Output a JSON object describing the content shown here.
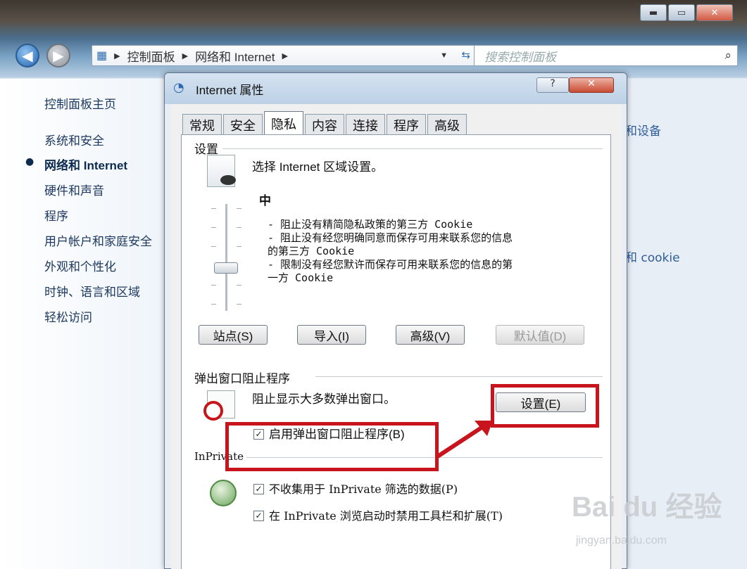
{
  "window": {
    "minimize": "▬",
    "maximize": "▭",
    "close": "✕"
  },
  "nav": {
    "back_icon": "◀",
    "forward_icon": "▶",
    "breadcrumb": [
      "控制面板",
      "网络和 Internet"
    ],
    "search_placeholder": "搜索控制面板"
  },
  "left_pane": {
    "home": "控制面板主页",
    "items": [
      "系统和安全",
      "网络和 Internet",
      "硬件和声音",
      "程序",
      "用户帐户和家庭安全",
      "外观和个性化",
      "时钟、语言和区域",
      "轻松访问"
    ],
    "active_index": 1
  },
  "right_fragments": [
    "和设备",
    "和 cookie"
  ],
  "dialog": {
    "title": "Internet 属性",
    "help": "?",
    "close": "✕",
    "tabs": [
      "常规",
      "安全",
      "隐私",
      "内容",
      "连接",
      "程序",
      "高级"
    ],
    "active_tab": "隐私",
    "settings_group": "设置",
    "settings_desc": "选择 Internet 区域设置。",
    "level": "中",
    "level_lines": [
      "- 阻止没有精简隐私政策的第三方 Cookie",
      "- 阻止没有经您明确同意而保存可用来联系您的信息",
      "的第三方 Cookie",
      "- 限制没有经您默许而保存可用来联系您的信息的第",
      "一方 Cookie"
    ],
    "buttons": {
      "sites": "站点(S)",
      "import": "导入(I)",
      "advanced": "高级(V)",
      "default": "默认值(D)"
    },
    "popup_group": "弹出窗口阻止程序",
    "popup_desc": "阻止显示大多数弹出窗口。",
    "popup_settings": "设置(E)",
    "popup_enable": "启用弹出窗口阻止程序(B)",
    "popup_enable_checked": true,
    "inprivate_group": "InPrivate",
    "inprivate_opt1": "不收集用于 InPrivate 筛选的数据(P)",
    "inprivate_opt2": "在 InPrivate 浏览启动时禁用工具栏和扩展(T)",
    "inprivate_opt1_checked": true,
    "inprivate_opt2_checked": true
  },
  "watermark": {
    "logo": "Bai du 经验",
    "url": "jingyan.baidu.com"
  },
  "highlight_color": "#c8141d"
}
